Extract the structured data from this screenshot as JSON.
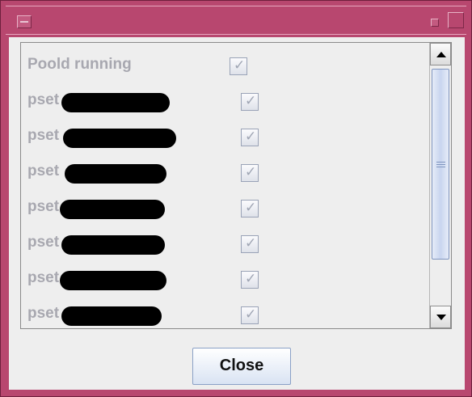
{
  "titlebar": {
    "minimize_icon": "minimize-icon",
    "small_button_icon": "restore-icon",
    "maximize_icon": "maximize-icon"
  },
  "list": {
    "items": [
      {
        "label": "Poold running",
        "checked": true,
        "redacted": false
      },
      {
        "label": "pset",
        "checked": true,
        "redacted": true
      },
      {
        "label": "pset",
        "checked": true,
        "redacted": true
      },
      {
        "label": "pset",
        "checked": true,
        "redacted": true
      },
      {
        "label": "pset",
        "checked": true,
        "redacted": true
      },
      {
        "label": "pset",
        "checked": true,
        "redacted": true
      },
      {
        "label": "pset",
        "checked": true,
        "redacted": true
      },
      {
        "label": "pset",
        "checked": true,
        "redacted": true
      }
    ]
  },
  "scrollbar": {
    "up_icon": "arrow-up-icon",
    "down_icon": "arrow-down-icon"
  },
  "footer": {
    "close_label": "Close"
  },
  "colors": {
    "titlebar": "#b8476f",
    "window_bg": "#eeeeee",
    "disabled_text": "#a8a8b0"
  }
}
